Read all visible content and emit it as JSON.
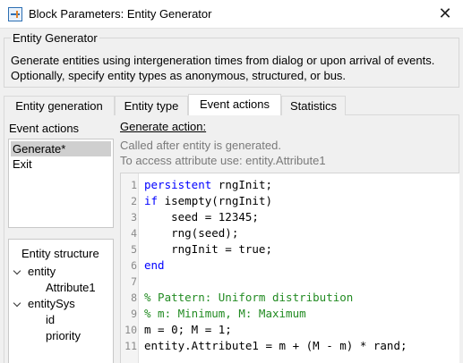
{
  "window": {
    "title": "Block Parameters: Entity Generator",
    "close_glyph": "✕",
    "icon": "simulink-block-icon"
  },
  "block": {
    "group_title": "Entity Generator",
    "description": "Generate entities using intergeneration times from dialog or upon arrival of events. Optionally, specify entity types as anonymous, structured, or bus."
  },
  "tabs": [
    {
      "label": "Entity generation",
      "active": false
    },
    {
      "label": "Entity type",
      "active": false
    },
    {
      "label": "Event actions",
      "active": true
    },
    {
      "label": "Statistics",
      "active": false
    }
  ],
  "event_actions": {
    "label": "Event actions",
    "items": [
      {
        "label": "Generate*",
        "selected": true
      },
      {
        "label": "Exit",
        "selected": false
      }
    ]
  },
  "entity_structure": {
    "title": "Entity structure",
    "tree": [
      {
        "label": "entity",
        "level": 0,
        "expanded": true
      },
      {
        "label": "Attribute1",
        "level": 1
      },
      {
        "label": "entitySys",
        "level": 0,
        "expanded": true
      },
      {
        "label": "id",
        "level": 1
      },
      {
        "label": "priority",
        "level": 1
      }
    ]
  },
  "generate_action": {
    "label": "Generate action:",
    "hint1": "Called after entity is generated.",
    "hint2": "To access attribute use: entity.Attribute1"
  },
  "editor": {
    "colors": {
      "keyword": "#0000ff",
      "comment": "#228b22",
      "default": "#000000"
    },
    "lines": [
      {
        "n": "1",
        "text": "persistent rngInit;",
        "kind": "keyword-lead",
        "kw": "persistent",
        "rest": " rngInit;"
      },
      {
        "n": "2",
        "text": "if isempty(rngInit)",
        "kind": "keyword-lead",
        "kw": "if",
        "rest": " isempty(rngInit)"
      },
      {
        "n": "3",
        "text": "    seed = 12345;",
        "kind": "plain"
      },
      {
        "n": "4",
        "text": "    rng(seed);",
        "kind": "plain"
      },
      {
        "n": "5",
        "text": "    rngInit = true;",
        "kind": "plain"
      },
      {
        "n": "6",
        "text": "end",
        "kind": "keyword"
      },
      {
        "n": "7",
        "text": "",
        "kind": "plain"
      },
      {
        "n": "8",
        "text": "% Pattern: Uniform distribution",
        "kind": "comment"
      },
      {
        "n": "9",
        "text": "% m: Minimum, M: Maximum",
        "kind": "comment"
      },
      {
        "n": "10",
        "text": "m = 0; M = 1;",
        "kind": "plain"
      },
      {
        "n": "11",
        "text": "entity.Attribute1 = m + (M - m) * rand;",
        "kind": "plain"
      }
    ]
  }
}
